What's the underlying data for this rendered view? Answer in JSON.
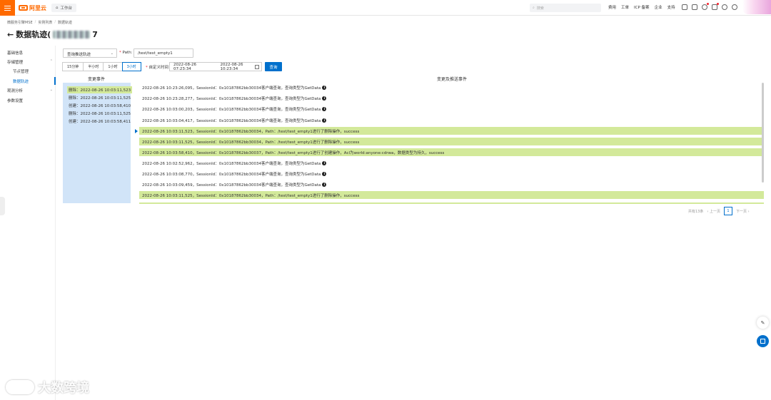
{
  "topbar": {
    "logo_text": "阿里云",
    "workbench_label": "工作台",
    "search_placeholder": "搜索",
    "nav": [
      "费用",
      "工单",
      "ICP 备案",
      "企业",
      "支持"
    ]
  },
  "breadcrumb": [
    "微服务引擎MSE",
    "实例列表",
    "数据轨迹"
  ],
  "page": {
    "title": "数据轨迹(",
    "title_tail": "7"
  },
  "sidebar": {
    "items": [
      {
        "label": "基础信息"
      },
      {
        "label": "存储管理"
      },
      {
        "label": "节点管理"
      },
      {
        "label": "数据轨迹"
      },
      {
        "label": "观测分析"
      },
      {
        "label": "参数设置"
      }
    ]
  },
  "filters": {
    "query_type": "查询推送轨迹",
    "path_label": "Path:",
    "path_value": "/test/test_empty1",
    "time_buttons": [
      "15分钟",
      "半小时",
      "1小时",
      "3小时"
    ],
    "active_time": "3小时",
    "custom_time_label": "自定义时间",
    "range_start": "2022-08-26 07:23:34",
    "range_end": "2022-08-26 10:23:34",
    "query_button": "查询"
  },
  "left_panel": {
    "header": "变更事件",
    "rows": [
      "删除：2022-08-26 10:03:11,523",
      "删除：2022-08-26 10:03:11,525",
      "创建：2022-08-26 10:03:58,410",
      "删除：2022-08-26 10:03:11,525",
      "创建：2022-08-26 10:03:58,411"
    ]
  },
  "right_panel": {
    "header": "变更及推送事件",
    "rows": [
      {
        "text": "2022-08-26 10:23:26,095，SessionId：0x10187862bb30034客户端查询，查询类型为GetData",
        "info": true,
        "hl": false
      },
      {
        "text": "2022-08-26 10:23:28,277，SessionId：0x10187862bb30034客户端查询，查询类型为GetData",
        "info": true,
        "hl": false
      },
      {
        "text": "2022-08-26 10:03:00,203，SessionId：0x10187862bb30034客户端查询，查询类型为GetData",
        "info": true,
        "hl": false
      },
      {
        "text": "2022-08-26 10:03:04,417，SessionId：0x10187862bb30034客户端查询，查询类型为GetData",
        "info": true,
        "hl": false
      },
      {
        "text": "2022-08-26 10:03:11,523，SessionId：0x10187862bb30034，Path：/test/test_empty1进行了删除操作，success",
        "info": false,
        "hl": true
      },
      {
        "text": "2022-08-26 10:03:11,525，SessionId：0x10187862bb30034，Path：/test/test_empty1进行了删除操作，success",
        "info": false,
        "hl": true
      },
      {
        "text": "2022-08-26 10:03:58,410，SessionId：0x10187862bb30037，Path：/test/test_empty1进行了创建操作，Acl为world:anyone:cdrwa，数据类型为持久，success",
        "info": false,
        "hl": true
      },
      {
        "text": "2022-08-26 10:02:52,962，SessionId：0x10187862bb30034客户端查询，查询类型为GetData",
        "info": true,
        "hl": false
      },
      {
        "text": "2022-08-26 10:03:08,770，SessionId：0x10187862bb30034客户端查询，查询类型为GetData",
        "info": true,
        "hl": false
      },
      {
        "text": "2022-08-26 10:03:09,459，SessionId：0x10187862bb30034客户端查询，查询类型为GetData",
        "info": true,
        "hl": false
      },
      {
        "text": "2022-08-26 10:03:11,525，SessionId：0x10187862bb30034，Path：/test/test_empty1进行了删除操作，success",
        "info": false,
        "hl": true
      }
    ]
  },
  "pager": {
    "total": "共有13条",
    "prev": "上一页",
    "current": "1",
    "next": "下一页"
  },
  "watermark": "大数跨境",
  "colors": {
    "brand": "#ff6a00",
    "primary": "#0070cc",
    "highlight": "#d3e99a",
    "left_panel_bg": "#d1e4f8"
  }
}
